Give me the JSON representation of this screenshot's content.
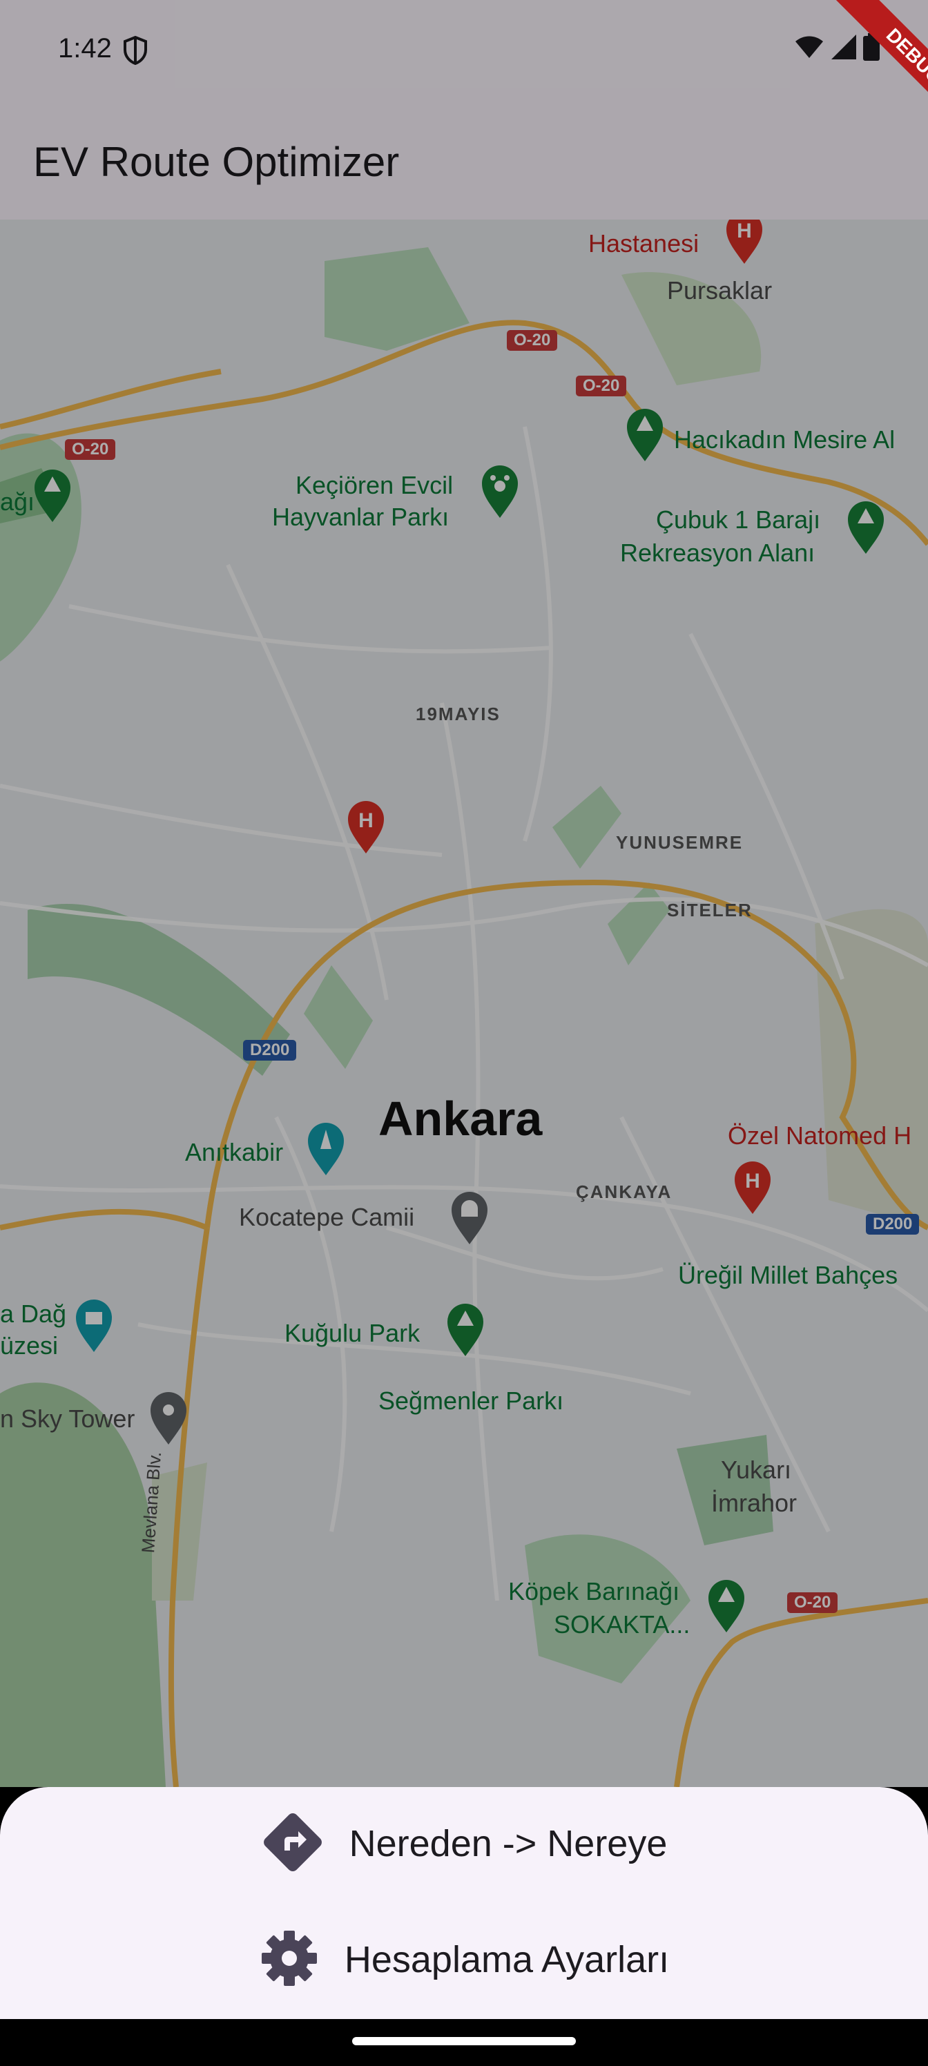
{
  "status_bar": {
    "time": "1:42"
  },
  "app_bar": {
    "title": "EV Route Optimizer"
  },
  "debug_banner": {
    "label": "DEBUG"
  },
  "map": {
    "labels": {
      "hastanesi": "Hastanesi",
      "pursaklar": "Pursaklar",
      "road_o20_a": "O-20",
      "road_o20_b": "O-20",
      "road_o20_c": "O-20",
      "road_o20_d": "O-20",
      "hacikadin": "Hacıkadın Mesire Al",
      "kecioren_1": "Keçiören Evcil",
      "kecioren_2": "Hayvanlar Parkı",
      "cubuk_1": "Çubuk 1 Barajı",
      "cubuk_2": "Rekreasyon Alanı",
      "dagi": "ağı",
      "mayis": "19MAYIS",
      "yunusemre": "YUNUSEMRE",
      "siteler": "SİTELER",
      "d200_a": "D200",
      "d200_b": "D200",
      "city": "Ankara",
      "anitkabir": "Anıtkabir",
      "ozel_natomed": "Özel Natomed H",
      "cankaya": "ÇANKAYA",
      "kocatepe": "Kocatepe Camii",
      "uregil": "Üreğil Millet Bahçes",
      "dag_muzesi_1": "a Dağ",
      "dag_muzesi_2": "üzesi",
      "kugulu": "Kuğulu Park",
      "segmenler": "Seğmenler Parkı",
      "sky_tower": "n Sky Tower",
      "yukari_1": "Yukarı",
      "yukari_2": "İmrahor",
      "mevlana": "Mevlana Blv.",
      "kopek_1": "Köpek Barınağı",
      "kopek_2": "SOKAKTA..."
    }
  },
  "bottom_sheet": {
    "route_label": "Nereden -> Nereye",
    "settings_label": "Hesaplama Ayarları"
  },
  "colors": {
    "surface": "#fef7ff",
    "sheet": "#f7f2fa",
    "park_green": "#0c7a39",
    "hospital_red": "#c5221f",
    "highway_orange": "#f2b94e"
  },
  "icons": [
    "shield-icon",
    "wifi-icon",
    "signal-icon",
    "battery-icon",
    "directions-icon",
    "gear-icon"
  ]
}
